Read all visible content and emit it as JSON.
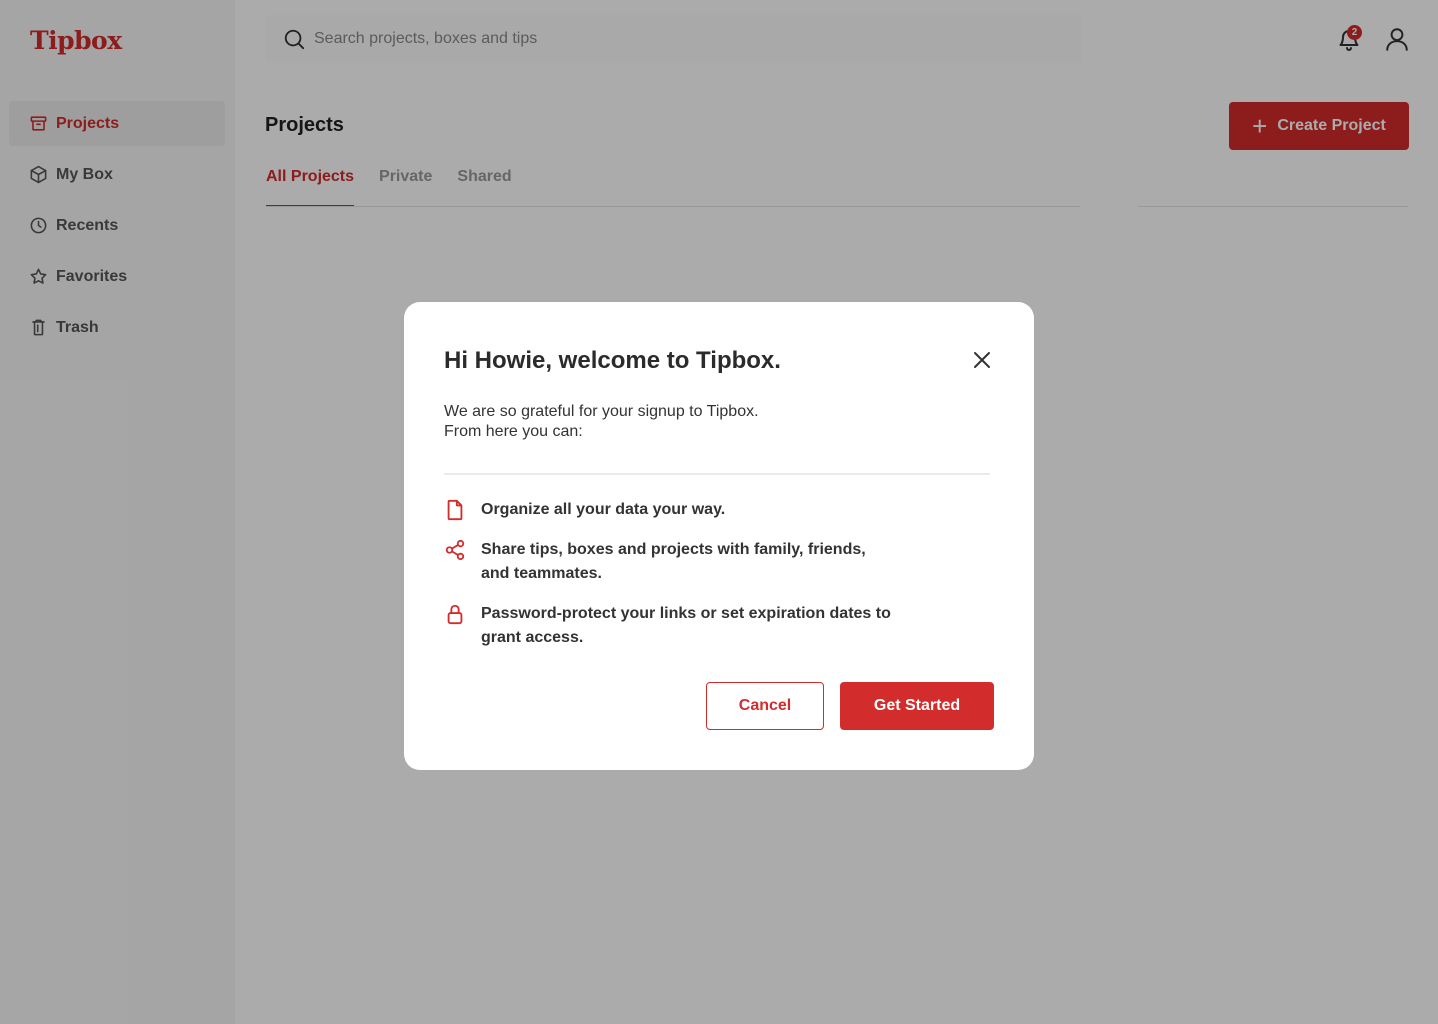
{
  "app": {
    "logo": "Tipbox"
  },
  "colors": {
    "accent": "#d22c2c",
    "sidebar_bg": "#f7f7f7",
    "text": "#333333"
  },
  "sidebar": {
    "items": [
      {
        "label": "Projects",
        "icon": "archive-icon",
        "active": true
      },
      {
        "label": "My Box",
        "icon": "box-icon",
        "active": false
      },
      {
        "label": "Recents",
        "icon": "clock-icon",
        "active": false
      },
      {
        "label": "Favorites",
        "icon": "star-icon",
        "active": false
      },
      {
        "label": "Trash",
        "icon": "trash-icon",
        "active": false
      }
    ]
  },
  "header": {
    "search_placeholder": "Search projects, boxes and tips",
    "notification_count": "2"
  },
  "main": {
    "title": "Projects",
    "create_label": "Create Project",
    "tabs": [
      {
        "label": "All Projects",
        "active": true
      },
      {
        "label": "Private",
        "active": false
      },
      {
        "label": "Shared",
        "active": false
      }
    ]
  },
  "modal": {
    "title": "Hi Howie, welcome to Tipbox.",
    "intro_line1": "We are so grateful for your signup to Tipbox.",
    "intro_line2": "From here you can:",
    "features": [
      {
        "icon": "document-icon",
        "text": "Organize all your data your way."
      },
      {
        "icon": "share-icon",
        "text": "Share tips, boxes and projects with family, friends, and teammates."
      },
      {
        "icon": "lock-icon",
        "text": "Password-protect your links or set expiration dates to grant access."
      }
    ],
    "cancel_label": "Cancel",
    "confirm_label": "Get Started"
  }
}
